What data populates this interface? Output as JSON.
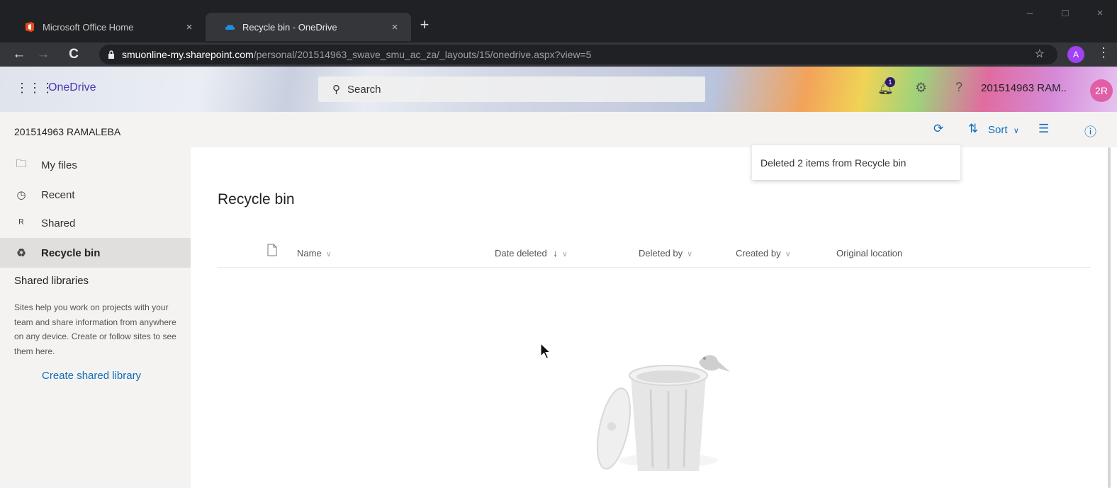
{
  "browser": {
    "tabs": [
      {
        "title": "Microsoft Office Home",
        "icon": "office-icon",
        "active": false
      },
      {
        "title": "Recycle bin - OneDrive",
        "icon": "onedrive-cloud-icon",
        "active": true
      }
    ],
    "tab_close": "×",
    "new_tab": "+",
    "url_host": "smuonline-my.sharepoint.com",
    "url_path": "/personal/201514963_swave_smu_ac_za/_layouts/15/onedrive.aspx?view=5",
    "profile_initial": "A",
    "window_controls": {
      "minimize": "–",
      "maximize": "□",
      "close": "×"
    }
  },
  "header": {
    "app_name": "OneDrive",
    "search_placeholder": "Search",
    "notification_count": "1",
    "user_name": "201514963 RAM..",
    "user_initials": "2R"
  },
  "commandbar": {
    "account": "201514963 RAMALEBA",
    "sort_label": "Sort"
  },
  "sidebar": {
    "items": [
      {
        "label": "My files",
        "icon": "folder-icon"
      },
      {
        "label": "Recent",
        "icon": "clock-icon"
      },
      {
        "label": "Shared",
        "icon": "people-icon"
      },
      {
        "label": "Recycle bin",
        "icon": "recycle-bin-icon",
        "selected": true
      }
    ],
    "libraries_heading": "Shared libraries",
    "libraries_description": "Sites help you work on projects with your team and share information from anywhere on any device. Create or follow sites to see them here.",
    "create_library": "Create shared library"
  },
  "main": {
    "title": "Recycle bin",
    "columns": [
      {
        "label": "Name",
        "sorted": false
      },
      {
        "label": "Date deleted",
        "sorted": true,
        "sort_arrow": "↓"
      },
      {
        "label": "Deleted by",
        "sorted": false
      },
      {
        "label": "Created by",
        "sorted": false
      },
      {
        "label": "Original location",
        "sorted": false
      }
    ]
  },
  "notification": {
    "message": "Deleted 2 items from Recycle bin"
  },
  "colors": {
    "accent": "#0f6cbd",
    "brand": "#4b37b8",
    "avatar": "#e05fa7"
  }
}
